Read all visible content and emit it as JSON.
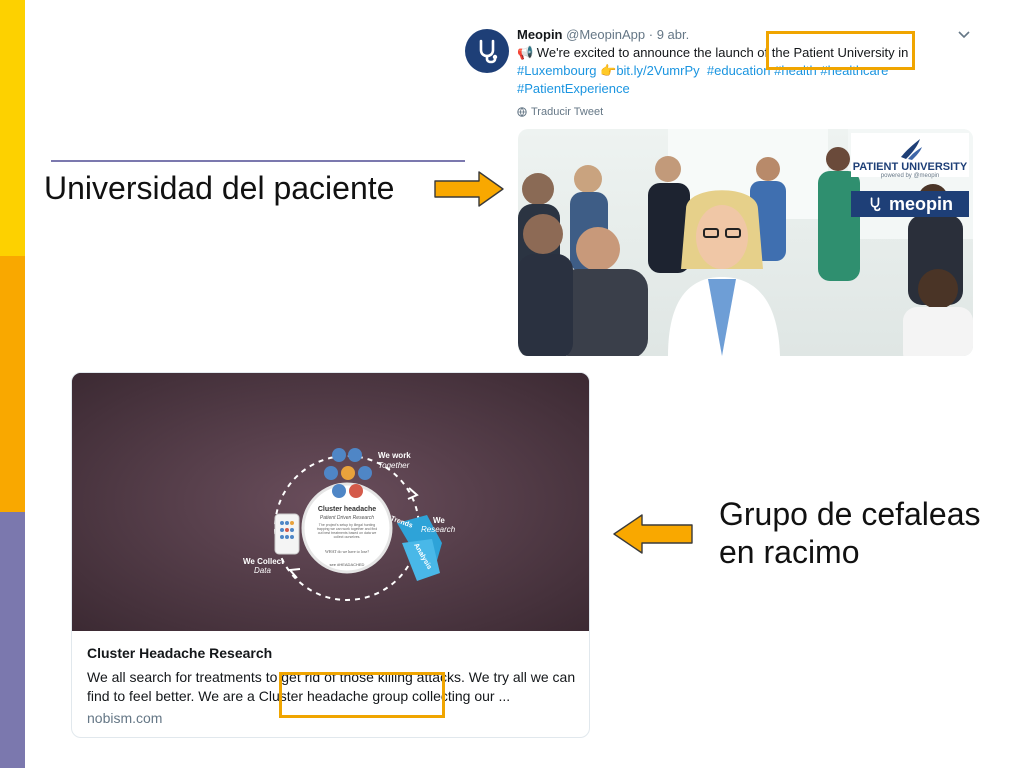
{
  "tweet": {
    "author_name": "Meopin",
    "author_handle": "@MeopinApp",
    "separator": "·",
    "date": "9 abr.",
    "line1_prefix": "📢 We're excited to announce the launch of ",
    "line1_highlight": "the Patient University in",
    "hashtag_luxembourg": "#Luxembourg",
    "pointer_emoji": "👉",
    "short_link": "bit.ly/2VumrPy",
    "hashtag_education": "#education",
    "hashtag_health": "#health",
    "hashtag_healthcare": "#healthcare",
    "hashtag_patientexperience": "#PatientExperience",
    "translate_label": "Traducir Tweet",
    "media": {
      "logo_title": "PATIENT UNIVERSITY",
      "logo_sub": "powered by @meopin",
      "brand": "meopin"
    }
  },
  "labels": {
    "patient_university": "Universidad del paciente",
    "cluster_line1": "Grupo de cefaleas",
    "cluster_line2": "en racimo"
  },
  "card": {
    "title": "Cluster Headache Research",
    "desc_part1": "We all search for treatments to get rid of those killing attacks. We try all we can find to feel better. We are a ",
    "desc_highlight": "Cluster headache group",
    "desc_part2": " collecting our ...",
    "domain": "nobism.com",
    "image": {
      "center_title": "Cluster headache",
      "center_sub": "Patient Driven Research",
      "center_body": "The project's setup by illegal hunting trapping we can work together and find out best treatments based on data we collect ourselves.",
      "center_q": "WHAT do we have to lose?",
      "center_tag": "see #HEADACHED",
      "we_work": "We work",
      "together": "Together",
      "we_research": "We",
      "research": "Research",
      "we_collect": "We Collect",
      "data": "Data",
      "trends": "Trends",
      "analysis": "Analysis"
    }
  },
  "colors": {
    "yellow": "#FDD100",
    "orange": "#F9A800",
    "purple": "#7B78AE",
    "highlight": "#F0A500",
    "twitter_blue": "#1B95E0",
    "meopin_navy": "#1E3F77"
  }
}
